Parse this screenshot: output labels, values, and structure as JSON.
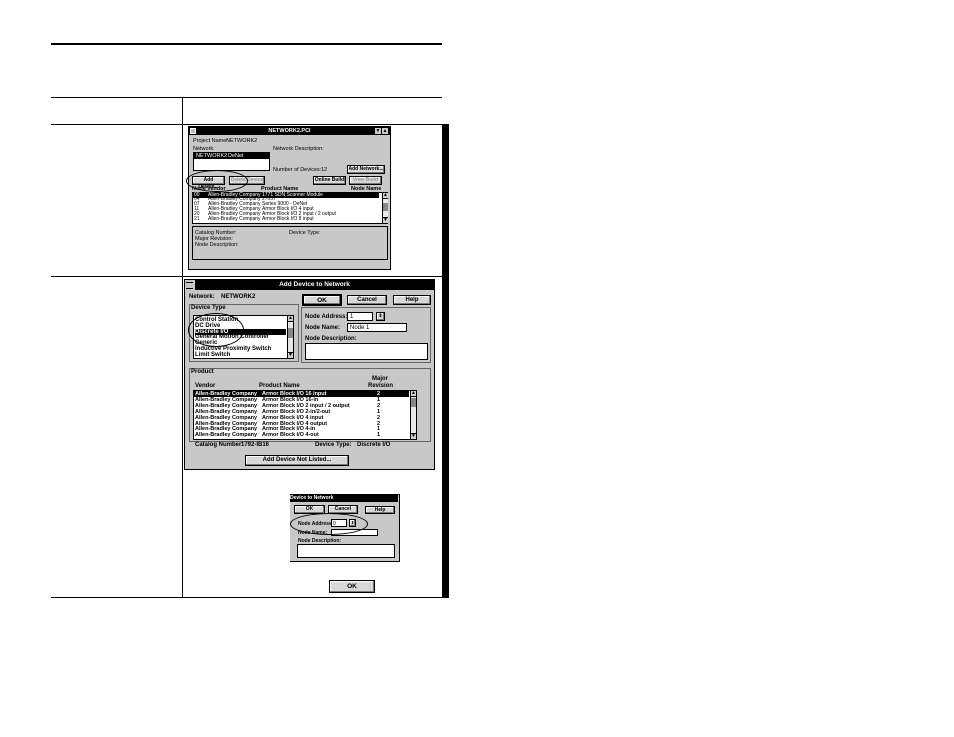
{
  "network_window": {
    "title": "NETWORK2.PCI",
    "project_name_label": "Project Name:",
    "project_name_value": "NETWORK2",
    "network_label": "Network:",
    "network_desc_label": "Network Description:",
    "network_list_item": "NETWORK2",
    "network_list_item_type": "DeNet",
    "num_devices_label": "Number of Devices:",
    "num_devices_value": "12",
    "add_network_button": "Add Network...",
    "add_device_button": "Add Device...",
    "delete_device_button": "Delete Device",
    "online_build_button": "Online Build",
    "view_build_button": "View Build",
    "columns": [
      "Node",
      "Vendor",
      "Product Name",
      "Node Name"
    ],
    "rows": [
      {
        "node": "00",
        "vendor": "Allen-Bradley Company",
        "product": "1771 SDN Scanner Module"
      },
      {
        "node": "04",
        "vendor": "Allen-Bradley Company",
        "product": "2705T"
      },
      {
        "node": "07",
        "vendor": "Allen-Bradley Company",
        "product": "Series 9000 - DeNet"
      },
      {
        "node": "11",
        "vendor": "Allen-Bradley Company",
        "product": "Armor Block I/O  4 input"
      },
      {
        "node": "20",
        "vendor": "Allen-Bradley Company",
        "product": "Armor Block I/O  2 input / 2 output"
      },
      {
        "node": "21",
        "vendor": "Allen-Bradley Company",
        "product": "Armor Block I/O  8 input"
      }
    ],
    "catalog_label": "Catalog Number:",
    "device_type_label": "Device Type:",
    "major_revision_label": "Major Revision:",
    "node_description_label": "Node Description:"
  },
  "add_device_window": {
    "title": "Add Device to Network",
    "network_label": "Network:",
    "network_value": "NETWORK2",
    "ok_button": "OK",
    "cancel_button": "Cancel",
    "help_button": "Help",
    "device_type_label": "Device Type",
    "device_types": [
      "Control Station",
      "DC Drive",
      "Discrete I/O",
      "General Motion Controller",
      "Generic",
      "Inductive Proximity Switch",
      "Limit Switch"
    ],
    "selected_device_type": "Discrete I/O",
    "node_address_label": "Node Address:",
    "node_address_value": "1",
    "node_name_label": "Node Name:",
    "node_name_value": "Node 1",
    "node_description_label": "Node Description:",
    "product_label": "Product",
    "columns": [
      "Vendor",
      "Product Name",
      "Major Revision"
    ],
    "products": [
      {
        "vendor": "Allen-Bradley Company",
        "product": "Armor Block I/O  16 input",
        "rev": "2"
      },
      {
        "vendor": "Allen-Bradley Company",
        "product": "Armor Block I/O  16-in",
        "rev": "1"
      },
      {
        "vendor": "Allen-Bradley Company",
        "product": "Armor Block I/O  2 input / 2 output",
        "rev": "2"
      },
      {
        "vendor": "Allen-Bradley Company",
        "product": "Armor Block I/O  2-in/2-out",
        "rev": "1"
      },
      {
        "vendor": "Allen-Bradley Company",
        "product": "Armor Block I/O  4 input",
        "rev": "2"
      },
      {
        "vendor": "Allen-Bradley Company",
        "product": "Armor Block I/O  4 output",
        "rev": "2"
      },
      {
        "vendor": "Allen-Bradley Company",
        "product": "Armor Block I/O  4-in",
        "rev": "1"
      },
      {
        "vendor": "Allen-Bradley Company",
        "product": "Armor Block I/O  4-out",
        "rev": "1"
      }
    ],
    "catalog_label": "Catalog Number:",
    "catalog_value": "1792-IB16",
    "device_type_label2": "Device Type:",
    "device_type_value": "Discrete I/O",
    "add_not_listed_button": "Add Device Not Listed..."
  },
  "crop_window": {
    "title": "Device to Network",
    "ok_button": "OK",
    "cancel_button": "Cancel",
    "help_button": "Help",
    "node_address_label": "Node Address:",
    "node_address_value": "0",
    "node_name_label": "Node Name:",
    "node_description_label": "Node Description:"
  },
  "standalone_ok_button": "OK"
}
